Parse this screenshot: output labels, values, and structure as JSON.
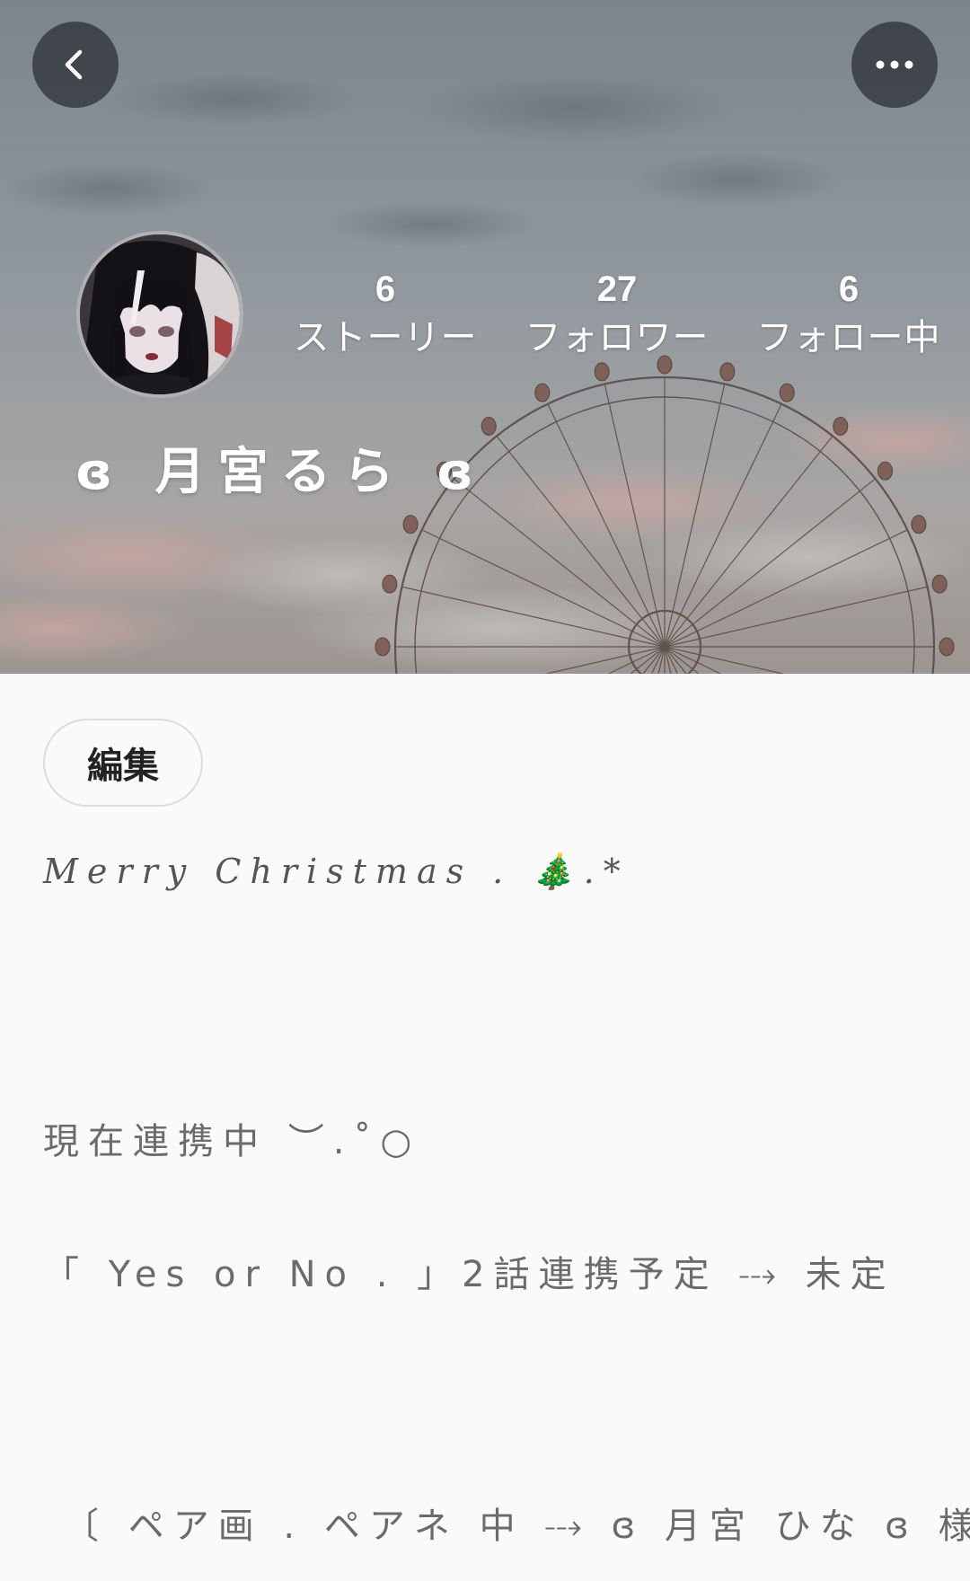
{
  "header": {
    "back_icon": "chevron-left-icon",
    "more_icon": "more-horizontal-icon"
  },
  "profile": {
    "username": "ɞ 月宮るら ɞ",
    "stats": [
      {
        "value": "6",
        "label": "ストーリー"
      },
      {
        "value": "27",
        "label": "フォロワー"
      },
      {
        "value": "6",
        "label": "フォロー中"
      }
    ],
    "edit_label": "編集"
  },
  "bio": {
    "line1": "𝑀𝑒𝑟𝑟𝑦 𝐶ℎ𝑟𝑖𝑠𝑡𝑚𝑎𝑠 . 🎄.*",
    "line2": "現在連携中 ︶.˚○",
    "line3": "「 Yes or No . 」2話連携予定 ⤏ 未定",
    "line4": "〔 ペア画 . ペアネ 中 ⤏ ɞ 月宮 ひな ɞ 様 〕"
  },
  "colors": {
    "background": "#fafafa",
    "button_overlay": "#282c32",
    "text_secondary": "#6b6b6b"
  }
}
